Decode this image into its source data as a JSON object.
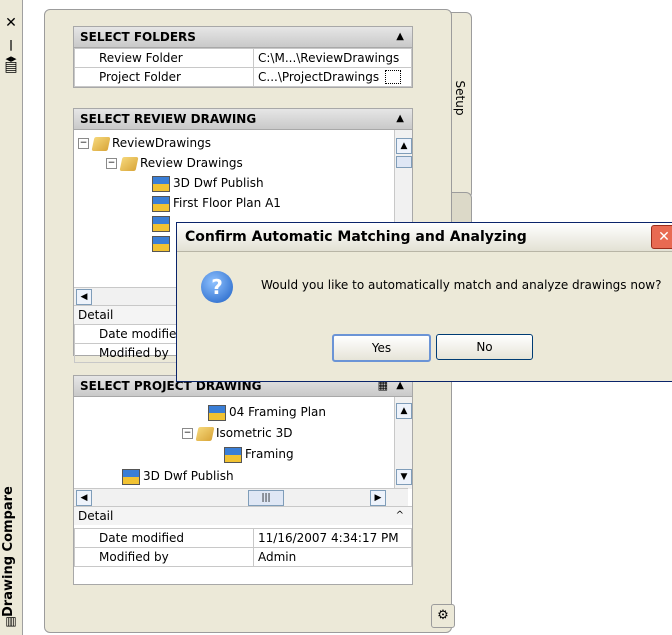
{
  "palette": {
    "title": "Drawing Compare",
    "tab_setup": "Setup",
    "strip_icons": [
      "close-icon",
      "auto-hide-icon",
      "properties-icon",
      "palette-icon"
    ]
  },
  "select_folders": {
    "header": "SELECT FOLDERS",
    "rows": [
      {
        "label": "Review Folder",
        "value": "C:\\M...\\ReviewDrawings"
      },
      {
        "label": "Project Folder",
        "value": "C...\\ProjectDrawings"
      }
    ]
  },
  "select_review": {
    "header": "SELECT REVIEW DRAWING",
    "tree": {
      "root": "ReviewDrawings",
      "folder": "Review Drawings",
      "items": [
        "3D Dwf Publish",
        "First Floor Plan A1"
      ]
    },
    "detail_label": "Detail",
    "props": [
      {
        "label": "Date modifie",
        "value": ""
      },
      {
        "label": "Modified by",
        "value": ""
      }
    ]
  },
  "select_project": {
    "header": "SELECT PROJECT DRAWING",
    "tree": {
      "item1": "04 Framing Plan",
      "folder": "Isometric 3D",
      "item2": "Framing",
      "item3": "3D Dwf Publish"
    },
    "detail_label": "Detail",
    "props": [
      {
        "label": "Date modified",
        "value": "11/16/2007 4:34:17 PM"
      },
      {
        "label": "Modified by",
        "value": "Admin"
      }
    ]
  },
  "dialog": {
    "title": "Confirm Automatic Matching and Analyzing",
    "message": "Would you like to automatically match and analyze drawings now?",
    "yes": "Yes",
    "no": "No"
  }
}
